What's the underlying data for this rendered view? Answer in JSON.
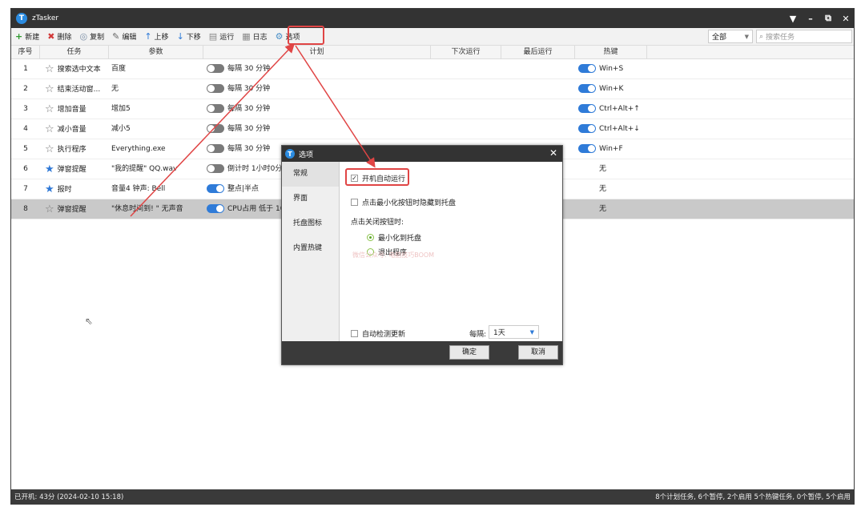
{
  "app": {
    "title": "zTasker",
    "logo_letter": "T"
  },
  "window_controls": {
    "menu": "▼",
    "minimize": "–",
    "restore": "⧉",
    "close": "✕"
  },
  "toolbar": {
    "new": "新建",
    "delete": "删除",
    "copy": "复制",
    "edit": "编辑",
    "move_up": "上移",
    "move_down": "下移",
    "run": "运行",
    "log": "日志",
    "options": "选项",
    "scope_value": "全部",
    "search_placeholder": "搜索任务"
  },
  "columns": {
    "index": "序号",
    "task": "任务",
    "param": "参数",
    "plan": "计划",
    "next_run": "下次运行",
    "last_run": "最后运行",
    "hotkey": "热键"
  },
  "rows": [
    {
      "index": "1",
      "task": "搜索选中文本",
      "param": "百度",
      "plan": "每隔 30 分钟",
      "hotkey": "Win+S",
      "starred": false,
      "plan_on": false,
      "hotkey_on": true
    },
    {
      "index": "2",
      "task": "结束活动窗...",
      "param": "无",
      "plan": "每隔 30 分钟",
      "hotkey": "Win+K",
      "starred": false,
      "plan_on": false,
      "hotkey_on": true
    },
    {
      "index": "3",
      "task": "增加音量",
      "param": "增加5",
      "plan": "每隔 30 分钟",
      "hotkey": "Ctrl+Alt+↑",
      "starred": false,
      "plan_on": false,
      "hotkey_on": true
    },
    {
      "index": "4",
      "task": "减小音量",
      "param": "减小5",
      "plan": "每隔 30 分钟",
      "hotkey": "Ctrl+Alt+↓",
      "starred": false,
      "plan_on": false,
      "hotkey_on": true
    },
    {
      "index": "5",
      "task": "执行程序",
      "param": "Everything.exe",
      "plan": "每隔 30 分钟",
      "hotkey": "Win+F",
      "starred": false,
      "plan_on": false,
      "hotkey_on": true
    },
    {
      "index": "6",
      "task": "弹窗提醒",
      "param": "\"我的提醒\" QQ.wav",
      "plan": "倒计时 1小时0分0秒",
      "hotkey": "无",
      "starred": true,
      "plan_on": false,
      "hotkey_on": null
    },
    {
      "index": "7",
      "task": "报时",
      "param": "音量4 钟声: Bell",
      "plan": "整点|半点",
      "hotkey": "无",
      "starred": true,
      "plan_on": true,
      "hotkey_on": null
    },
    {
      "index": "8",
      "task": "弹窗提醒",
      "param": "\"休息时间到! \" 无声音",
      "plan": "CPU占用 低于 10% 0",
      "hotkey": "无",
      "starred": false,
      "plan_on": true,
      "hotkey_on": null
    }
  ],
  "status": {
    "left": "已开机: 43分 (2024-02-10 15:18)",
    "right": "8个计划任务, 6个暂停, 2个启用   5个热键任务, 0个暂停, 5个启用"
  },
  "dialog": {
    "title": "选项",
    "close": "✕",
    "side_items": [
      "常规",
      "界面",
      "托盘图标",
      "内置热键"
    ],
    "autostart": "开机自动运行",
    "hide_to_tray": "点击最小化按钮时隐藏到托盘",
    "on_close_label": "点击关闭按钮时:",
    "minimize_to_tray": "最小化到托盘",
    "exit_program": "退出程序",
    "watermark": "微信公众号: 电脑技巧BOOM",
    "auto_update": "自动检测更新",
    "interval_label": "每隔:",
    "interval_value": "1天",
    "ok": "确定",
    "cancel": "取消"
  },
  "colors": {
    "accent": "#2f7bd8",
    "highlight": "#e04545",
    "dark": "#333333"
  }
}
